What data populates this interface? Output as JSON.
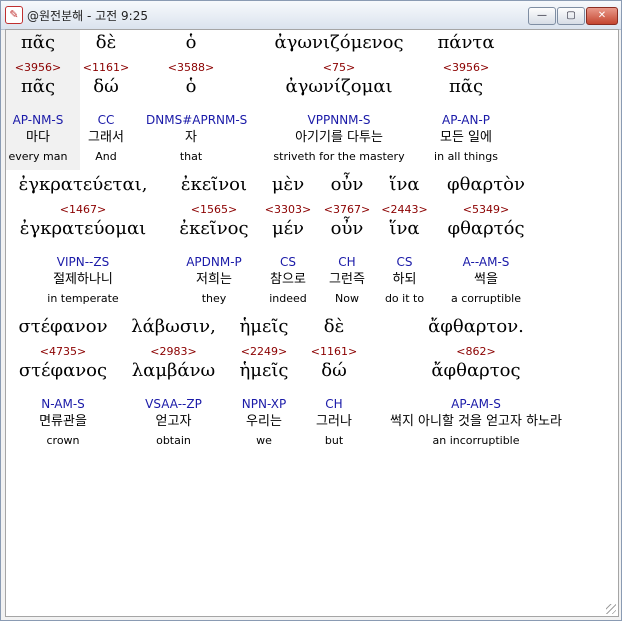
{
  "window": {
    "title": "@원전분해 - 고전 9:25",
    "minimize_label": "—",
    "maximize_label": "▢",
    "close_label": "✕",
    "icon": "app-icon"
  },
  "rows": [
    [
      {
        "surface": "πᾶς",
        "strongs": "<3956>",
        "lemma": "πᾶς",
        "morph": "AP-NM-S",
        "korean": "마다",
        "english": "every man"
      },
      {
        "surface": "δὲ",
        "strongs": "<1161>",
        "lemma": "δώ",
        "morph": "CC",
        "korean": "그래서",
        "english": "And"
      },
      {
        "surface": "ὁ",
        "strongs": "<3588>",
        "lemma": "ὁ",
        "morph": "DNMS#APRNM-S",
        "korean": "자",
        "english": "that"
      },
      {
        "surface": "ἀγωνιζόμενος",
        "strongs": "<75>",
        "lemma": "ἀγωνίζομαι",
        "morph": "VPPNNM-S",
        "korean": "아기기를 다투는",
        "english": "striveth for the mastery"
      },
      {
        "surface": "πάντα",
        "strongs": "<3956>",
        "lemma": "πᾶς",
        "morph": "AP-AN-P",
        "korean": "모든 일에",
        "english": "in all things"
      }
    ],
    [
      {
        "surface": "ἐγκρατεύεται,",
        "strongs": "<1467>",
        "lemma": "ἐγκρατεύομαι",
        "morph": "VIPN--ZS",
        "korean": "절제하나니",
        "english": "in temperate"
      },
      {
        "surface": "ἐκεῖνοι",
        "strongs": "<1565>",
        "lemma": "ἐκεῖνος",
        "morph": "APDNM-P",
        "korean": "저희는",
        "english": "they"
      },
      {
        "surface": "μὲν",
        "strongs": "<3303>",
        "lemma": "μέν",
        "morph": "CS",
        "korean": "참으로",
        "english": "indeed"
      },
      {
        "surface": "οὖν",
        "strongs": "<3767>",
        "lemma": "οὖν",
        "morph": "CH",
        "korean": "그런즉",
        "english": "Now"
      },
      {
        "surface": "ἵνα",
        "strongs": "<2443>",
        "lemma": "ἵνα",
        "morph": "CS",
        "korean": "하되",
        "english": "do it to"
      },
      {
        "surface": "φθαρτὸν",
        "strongs": "<5349>",
        "lemma": "φθαρτός",
        "morph": "A--AM-S",
        "korean": "썩을",
        "english": "a corruptible"
      }
    ],
    [
      {
        "surface": "στέφανον",
        "strongs": "<4735>",
        "lemma": "στέφανος",
        "morph": "N-AM-S",
        "korean": "면류관을",
        "english": "crown"
      },
      {
        "surface": "λάβωσιν,",
        "strongs": "<2983>",
        "lemma": "λαμβάνω",
        "morph": "VSAA--ZP",
        "korean": "얻고자",
        "english": "obtain"
      },
      {
        "surface": "ἡμεῖς",
        "strongs": "<2249>",
        "lemma": "ἡμεῖς",
        "morph": "NPN-XP",
        "korean": "우리는",
        "english": "we"
      },
      {
        "surface": "δὲ",
        "strongs": "<1161>",
        "lemma": "δώ",
        "morph": "CH",
        "korean": "그러나",
        "english": "but"
      },
      {
        "surface": "ἄφθαρτον.",
        "strongs": "<862>",
        "lemma": "ἄφθαρτος",
        "morph": "AP-AM-S",
        "korean": "썩지 아니할 것을 얻고자 하노라",
        "english": "an incorruptible"
      }
    ]
  ]
}
